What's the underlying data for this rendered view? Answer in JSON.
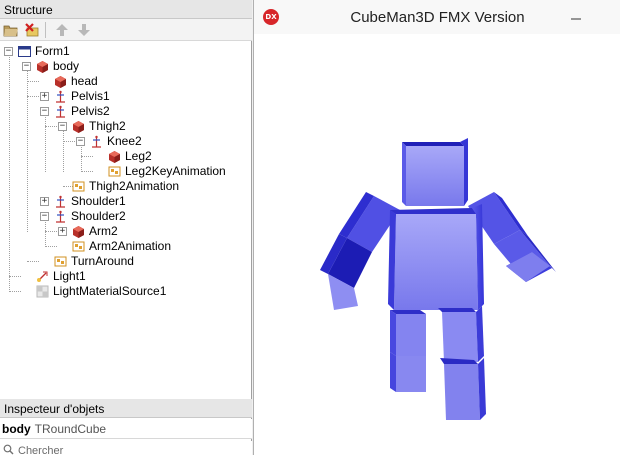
{
  "structure": {
    "title": "Structure",
    "toolbar": [
      "open-folder-icon",
      "delete-icon",
      "move-up-icon",
      "move-down-icon"
    ],
    "tree": [
      {
        "label": "Form1",
        "icon": "form-icon",
        "expander": "−"
      },
      {
        "label": "body",
        "icon": "cube-icon",
        "expander": "−"
      },
      {
        "label": "head",
        "icon": "cube-icon",
        "expander": ""
      },
      {
        "label": "Pelvis1",
        "icon": "dummy-icon",
        "expander": "+"
      },
      {
        "label": "Pelvis2",
        "icon": "dummy-icon",
        "expander": "−"
      },
      {
        "label": "Thigh2",
        "icon": "cube-icon",
        "expander": "−"
      },
      {
        "label": "Knee2",
        "icon": "dummy-icon",
        "expander": "−"
      },
      {
        "label": "Leg2",
        "icon": "cube-icon",
        "expander": ""
      },
      {
        "label": "Leg2KeyAnimation",
        "icon": "animation-icon",
        "expander": ""
      },
      {
        "label": "Thigh2Animation",
        "icon": "animation-icon",
        "expander": ""
      },
      {
        "label": "Shoulder1",
        "icon": "dummy-icon",
        "expander": "+"
      },
      {
        "label": "Shoulder2",
        "icon": "dummy-icon",
        "expander": "−"
      },
      {
        "label": "Arm2",
        "icon": "cube-icon",
        "expander": "+"
      },
      {
        "label": "Arm2Animation",
        "icon": "animation-icon",
        "expander": ""
      },
      {
        "label": "TurnAround",
        "icon": "animation-icon",
        "expander": ""
      },
      {
        "label": "Light1",
        "icon": "light-icon",
        "expander": ""
      },
      {
        "label": "LightMaterialSource1",
        "icon": "material-icon",
        "expander": ""
      }
    ]
  },
  "inspector": {
    "title": "Inspecteur d'objets",
    "object_name": "body",
    "object_class": "TRoundCube",
    "search_placeholder": "Chercher"
  },
  "window": {
    "app_icon_text": "DX",
    "title": "CubeMan3D FMX Version"
  },
  "colors": {
    "cube_front": "#8080f0",
    "cube_side": "#3c3ce0",
    "cube_top": "#2a2ad0",
    "tree_cube": "#c0302a"
  }
}
